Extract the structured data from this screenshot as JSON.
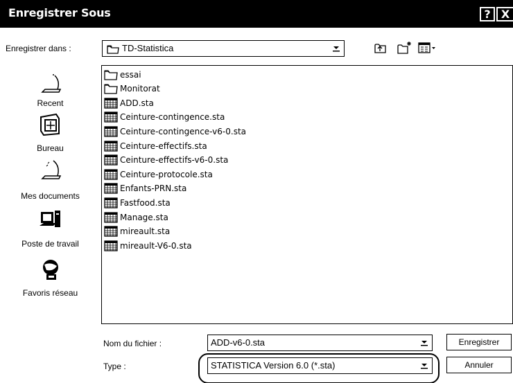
{
  "window": {
    "title": "Enregistrer Sous",
    "help_glyph": "?",
    "close_glyph": "X"
  },
  "save_in": {
    "label": "Enregistrer dans :",
    "value": "TD-Statistica"
  },
  "toolbar": {
    "up_icon": "up-folder-icon",
    "new_folder_icon": "new-folder-icon",
    "view_icon": "view-menu-icon"
  },
  "places": [
    {
      "label": "Recent",
      "icon": "recent-icon"
    },
    {
      "label": "Bureau",
      "icon": "desktop-icon"
    },
    {
      "label": "Mes documents",
      "icon": "documents-icon"
    },
    {
      "label": "Poste de travail",
      "icon": "computer-icon"
    },
    {
      "label": "Favoris réseau",
      "icon": "network-icon"
    }
  ],
  "files": [
    {
      "name": "essai",
      "kind": "folder"
    },
    {
      "name": "Monitorat",
      "kind": "folder"
    },
    {
      "name": "ADD.sta",
      "kind": "sta"
    },
    {
      "name": "Ceinture-contingence.sta",
      "kind": "sta"
    },
    {
      "name": "Ceinture-contingence-v6-0.sta",
      "kind": "sta"
    },
    {
      "name": "Ceinture-effectifs.sta",
      "kind": "sta"
    },
    {
      "name": "Ceinture-effectifs-v6-0.sta",
      "kind": "sta"
    },
    {
      "name": "Ceinture-protocole.sta",
      "kind": "sta"
    },
    {
      "name": "Enfants-PRN.sta",
      "kind": "sta"
    },
    {
      "name": "Fastfood.sta",
      "kind": "sta"
    },
    {
      "name": "Manage.sta",
      "kind": "sta"
    },
    {
      "name": "mireault.sta",
      "kind": "sta"
    },
    {
      "name": "mireault-V6-0.sta",
      "kind": "sta"
    }
  ],
  "filename": {
    "label": "Nom du fichier :",
    "value": "ADD-v6-0.sta"
  },
  "filetype": {
    "label": "Type :",
    "value": "STATISTICA Version 6.0 (*.sta)"
  },
  "buttons": {
    "save": "Enregistrer",
    "cancel": "Annuler"
  }
}
